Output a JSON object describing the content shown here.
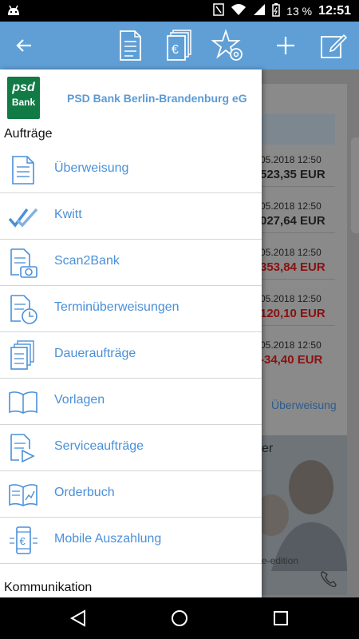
{
  "status_bar": {
    "battery": "13 %",
    "time": "12:51",
    "icons": [
      "android-icon",
      "nfc-icon",
      "wifi-icon",
      "signal-icon",
      "battery-icon"
    ]
  },
  "app_bar": {
    "color": "#5f9fd6",
    "icons": [
      "back-arrow-icon",
      "document-icon",
      "euro-documents-icon",
      "star-gear-icon",
      "plus-icon",
      "edit-icon"
    ]
  },
  "background": {
    "transactions": [
      {
        "date": "05.2018 12:50",
        "amount": "523,35 EUR",
        "negative": false
      },
      {
        "date": "05.2018 12:50",
        "amount": "027,64 EUR",
        "negative": false
      },
      {
        "date": "05.2018 12:50",
        "amount": "353,84 EUR",
        "negative": true
      },
      {
        "date": "05.2018 12:50",
        "amount": "120,10 EUR",
        "negative": true
      },
      {
        "date": "05.2018 12:50",
        "amount": "-34,40 EUR",
        "negative": true
      }
    ],
    "card_link": "Überweisung",
    "promo_fragment": "er",
    "promo_caption": "e-edition"
  },
  "drawer": {
    "bank_name": "PSD Bank Berlin-Brandenburg eG",
    "logo_text": [
      "psd",
      "Bank"
    ],
    "section_orders": "Aufträge",
    "items": [
      {
        "label": "Überweisung",
        "icon": "transfer-document-icon"
      },
      {
        "label": "Kwitt",
        "icon": "kwitt-check-icon"
      },
      {
        "label": "Scan2Bank",
        "icon": "camera-document-icon"
      },
      {
        "label": "Terminüberweisungen",
        "icon": "scheduled-transfer-icon"
      },
      {
        "label": "Daueraufträge",
        "icon": "standing-order-icon"
      },
      {
        "label": "Vorlagen",
        "icon": "templates-book-icon"
      },
      {
        "label": "Serviceaufträge",
        "icon": "service-order-icon"
      },
      {
        "label": "Orderbuch",
        "icon": "orderbook-icon"
      },
      {
        "label": "Mobile Auszahlung",
        "icon": "mobile-payout-icon"
      }
    ],
    "section_communication": "Kommunikation"
  },
  "colors": {
    "accent": "#4a90d9",
    "logo_green": "#117a45",
    "negative": "#b30000"
  }
}
